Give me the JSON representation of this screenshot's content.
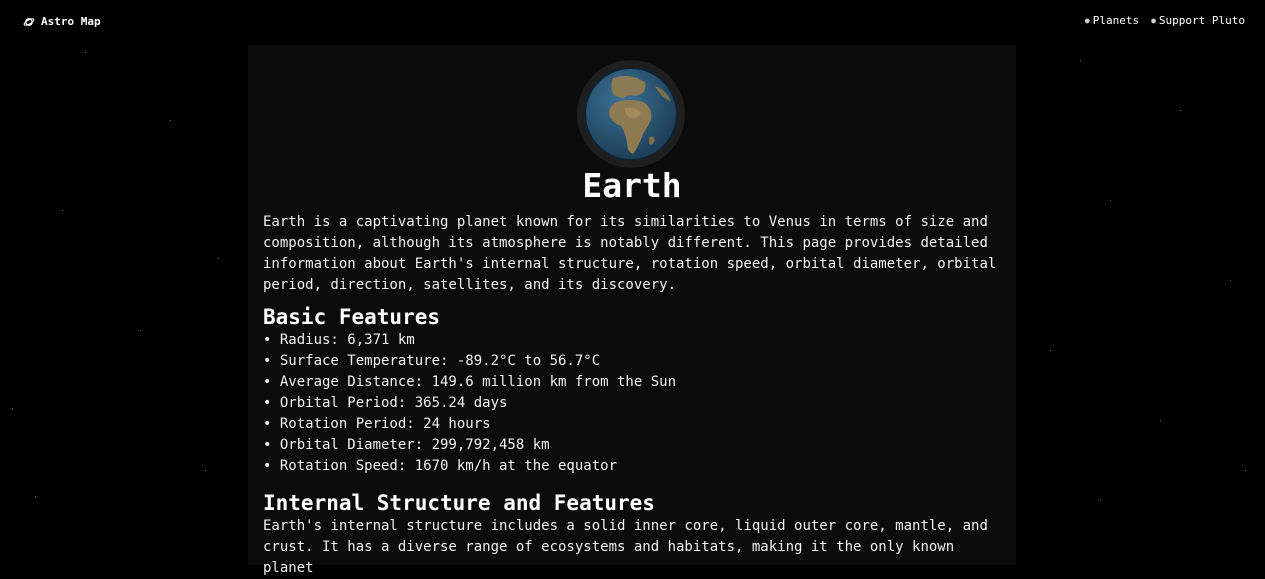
{
  "nav": {
    "brand": "Astro Map",
    "links": [
      "Planets",
      "Support Pluto"
    ]
  },
  "planet": {
    "name": "Earth",
    "intro": "Earth is a captivating planet known for its similarities to Venus in terms of size and composition, although its atmosphere is notably different. This page provides detailed information about Earth's internal structure, rotation speed, orbital diameter, orbital period, direction, satellites, and its discovery."
  },
  "basic_features": {
    "heading": "Basic Features",
    "items": [
      "Radius: 6,371 km",
      "Surface Temperature: -89.2°C to 56.7°C",
      "Average Distance: 149.6 million km from the Sun",
      "Orbital Period: 365.24 days",
      "Rotation Period: 24 hours",
      "Orbital Diameter: 299,792,458 km",
      "Rotation Speed: 1670 km/h at the equator"
    ]
  },
  "internal_structure": {
    "heading": "Internal Structure and Features",
    "text": "Earth's internal structure includes a solid inner core, liquid outer core, mantle, and crust. It has a diverse range of ecosystems and habitats, making it the only known planet"
  },
  "colors": {
    "background": "#000000",
    "panel": "#0b0b0b",
    "text": "#ffffff",
    "ocean": "#2f5d7c",
    "land": "#8a7a55"
  },
  "icons": {
    "brand": "planet-ring-icon"
  }
}
